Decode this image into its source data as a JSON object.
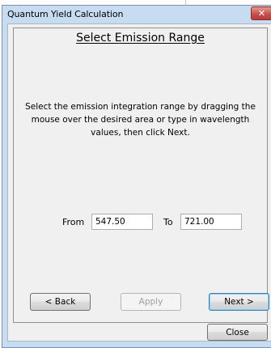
{
  "window": {
    "title": "Quantum Yield Calculation",
    "close_symbol": "✕"
  },
  "page": {
    "heading": "Select Emission Range",
    "instructions": "Select the emission integration range by dragging the mouse over the desired area or type in wavelength values, then click Next."
  },
  "range": {
    "from_label": "From",
    "from_value": "547.50",
    "to_label": "To",
    "to_value": "721.00"
  },
  "nav": {
    "back_label": "< Back",
    "apply_label": "Apply",
    "next_label": "Next >"
  },
  "footer": {
    "close_label": "Close"
  },
  "colors": {
    "frame": "#c7dcf1",
    "client": "#f0f0f0",
    "close_button": "#c75050",
    "default_button_border": "#3c7fb1"
  },
  "icons": {
    "close": "close-icon"
  }
}
